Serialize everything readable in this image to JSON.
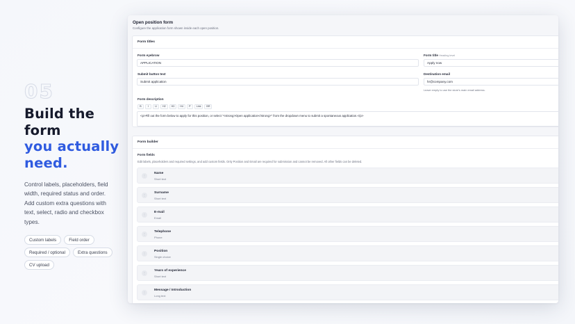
{
  "hero": {
    "step_number": "05",
    "headline_line1": "Build the",
    "headline_line2": "form",
    "headline_accent_line1": "you actually",
    "headline_accent_line2": "need.",
    "description": "Control labels, placeholders, field width, required status and order. Add custom extra questions with text, select, radio and checkbox types.",
    "pills": [
      "Custom labels",
      "Field order",
      "Required / optional",
      "Extra questions",
      "CV upload"
    ]
  },
  "panel": {
    "title": "Open position form",
    "subtitle": "Configure the application form shown inside each open position."
  },
  "form_titles": {
    "card_title": "Form titles",
    "eyebrow_label": "Form eyebrow",
    "eyebrow_value": "APPLICATION",
    "title_label": "Form title",
    "title_note": "Heading level",
    "title_value": "Apply now",
    "submit_label": "Submit button text",
    "submit_value": "Submit application",
    "email_label": "Destination email",
    "email_value": "hr@company.com",
    "email_help": "Leave empty to use the store's main email address.",
    "description_label": "Form description",
    "toolbar": [
      "B",
      "I",
      "U",
      "H2",
      "H3",
      "H4",
      "P",
      "Link",
      "BR"
    ],
    "description_value": "<p>Fill out the form below to apply for this position, or select \"<strong>Open application</strong>\" from the dropdown menu to submit a spontaneous application.</p>"
  },
  "form_builder": {
    "card_title": "Form builder",
    "fields_title": "Form fields",
    "fields_desc": "Edit labels, placeholders and required settings, and add custom fields. Only Position and Email are required for submission and cannot be removed. All other fields can be deleted.",
    "drag_glyph": "⋮",
    "fields": [
      {
        "name": "Name",
        "type": "Short text"
      },
      {
        "name": "Surname",
        "type": "Short text"
      },
      {
        "name": "E-mail",
        "type": "Email"
      },
      {
        "name": "Telephone",
        "type": "Phone"
      },
      {
        "name": "Position",
        "type": "Single choice"
      },
      {
        "name": "Years of experience",
        "type": "Short text"
      },
      {
        "name": "Message / Introduction",
        "type": "Long text"
      }
    ]
  },
  "colors": {
    "accent": "#2f5be0",
    "headline": "#161a2c"
  }
}
